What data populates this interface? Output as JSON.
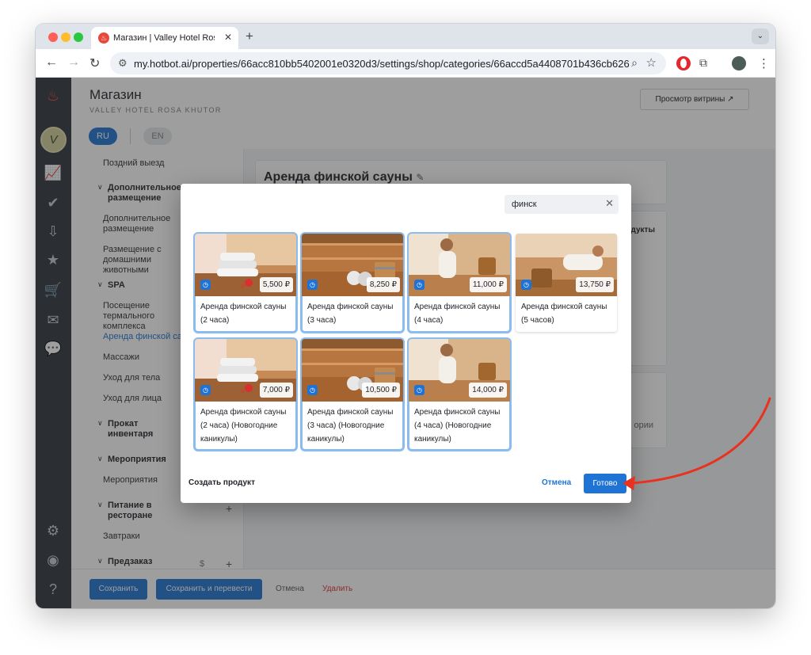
{
  "browser": {
    "tab_title": "Магазин | Valley Hotel Rosa Khutor",
    "url": "my.hotbot.ai/properties/66acc810bb5402001e0320d3/settings/shop/categories/66accd5a4408701b436cb626"
  },
  "header": {
    "title": "Магазин",
    "subtitle": "VALLEY HOTEL ROSA KHUTOR",
    "preview_label": "Просмотр витрины",
    "lang_ru": "RU",
    "lang_en": "EN"
  },
  "categories": {
    "late_checkout": "Поздний выезд",
    "extra_head": "Дополнительное размещение",
    "extra_item": "Дополнительное размещение",
    "pets_item": "Размещение с домашними животными",
    "spa_head": "SPA",
    "thermal_item": "Посещение термального комплекса",
    "sauna_item": "Аренда финской сауны",
    "massage_item": "Массажи",
    "body_item": "Уход для тела",
    "face_item": "Уход для лица",
    "rental_head": "Прокат инвентаря",
    "events_head": "Мероприятия",
    "events_item": "Мероприятия",
    "food_head": "Питание в ресторане",
    "breakfast_item": "Завтраки",
    "preorder_head": "Предзаказ"
  },
  "main": {
    "category_title": "Аренда финской сауны",
    "products_label": "дукты",
    "category_hint": "ории"
  },
  "footer": {
    "save": "Сохранить",
    "save_translate": "Сохранить и перевести",
    "cancel": "Отмена",
    "delete": "Удалить"
  },
  "modal": {
    "search_value": "финск",
    "create_product": "Создать продукт",
    "cancel": "Отмена",
    "done": "Готово",
    "products": [
      {
        "name": "Аренда финской сауны (2 часа)",
        "price": "5,500 ₽",
        "selected": true,
        "image": "towels"
      },
      {
        "name": "Аренда финской сауны (3 часа)",
        "price": "8,250 ₽",
        "selected": true,
        "image": "bucket"
      },
      {
        "name": "Аренда финской сауны (4 часа)",
        "price": "11,000 ₽",
        "selected": true,
        "image": "woman"
      },
      {
        "name": "Аренда финской сауны (5 часов)",
        "price": "13,750 ₽",
        "selected": false,
        "image": "relax"
      },
      {
        "name": "Аренда финской сауны (2 часа) (Новогодние каникулы)",
        "price": "7,000 ₽",
        "selected": true,
        "image": "towels"
      },
      {
        "name": "Аренда финской сауны (3 часа) (Новогодние каникулы)",
        "price": "10,500 ₽",
        "selected": true,
        "image": "bucket"
      },
      {
        "name": "Аренда финской сауны (4 часа) (Новогодние каникулы)",
        "price": "14,000 ₽",
        "selected": true,
        "image": "woman"
      }
    ]
  },
  "colors": {
    "accent": "#1e73d4",
    "danger": "#d8322d",
    "arrow": "#e8321f"
  }
}
